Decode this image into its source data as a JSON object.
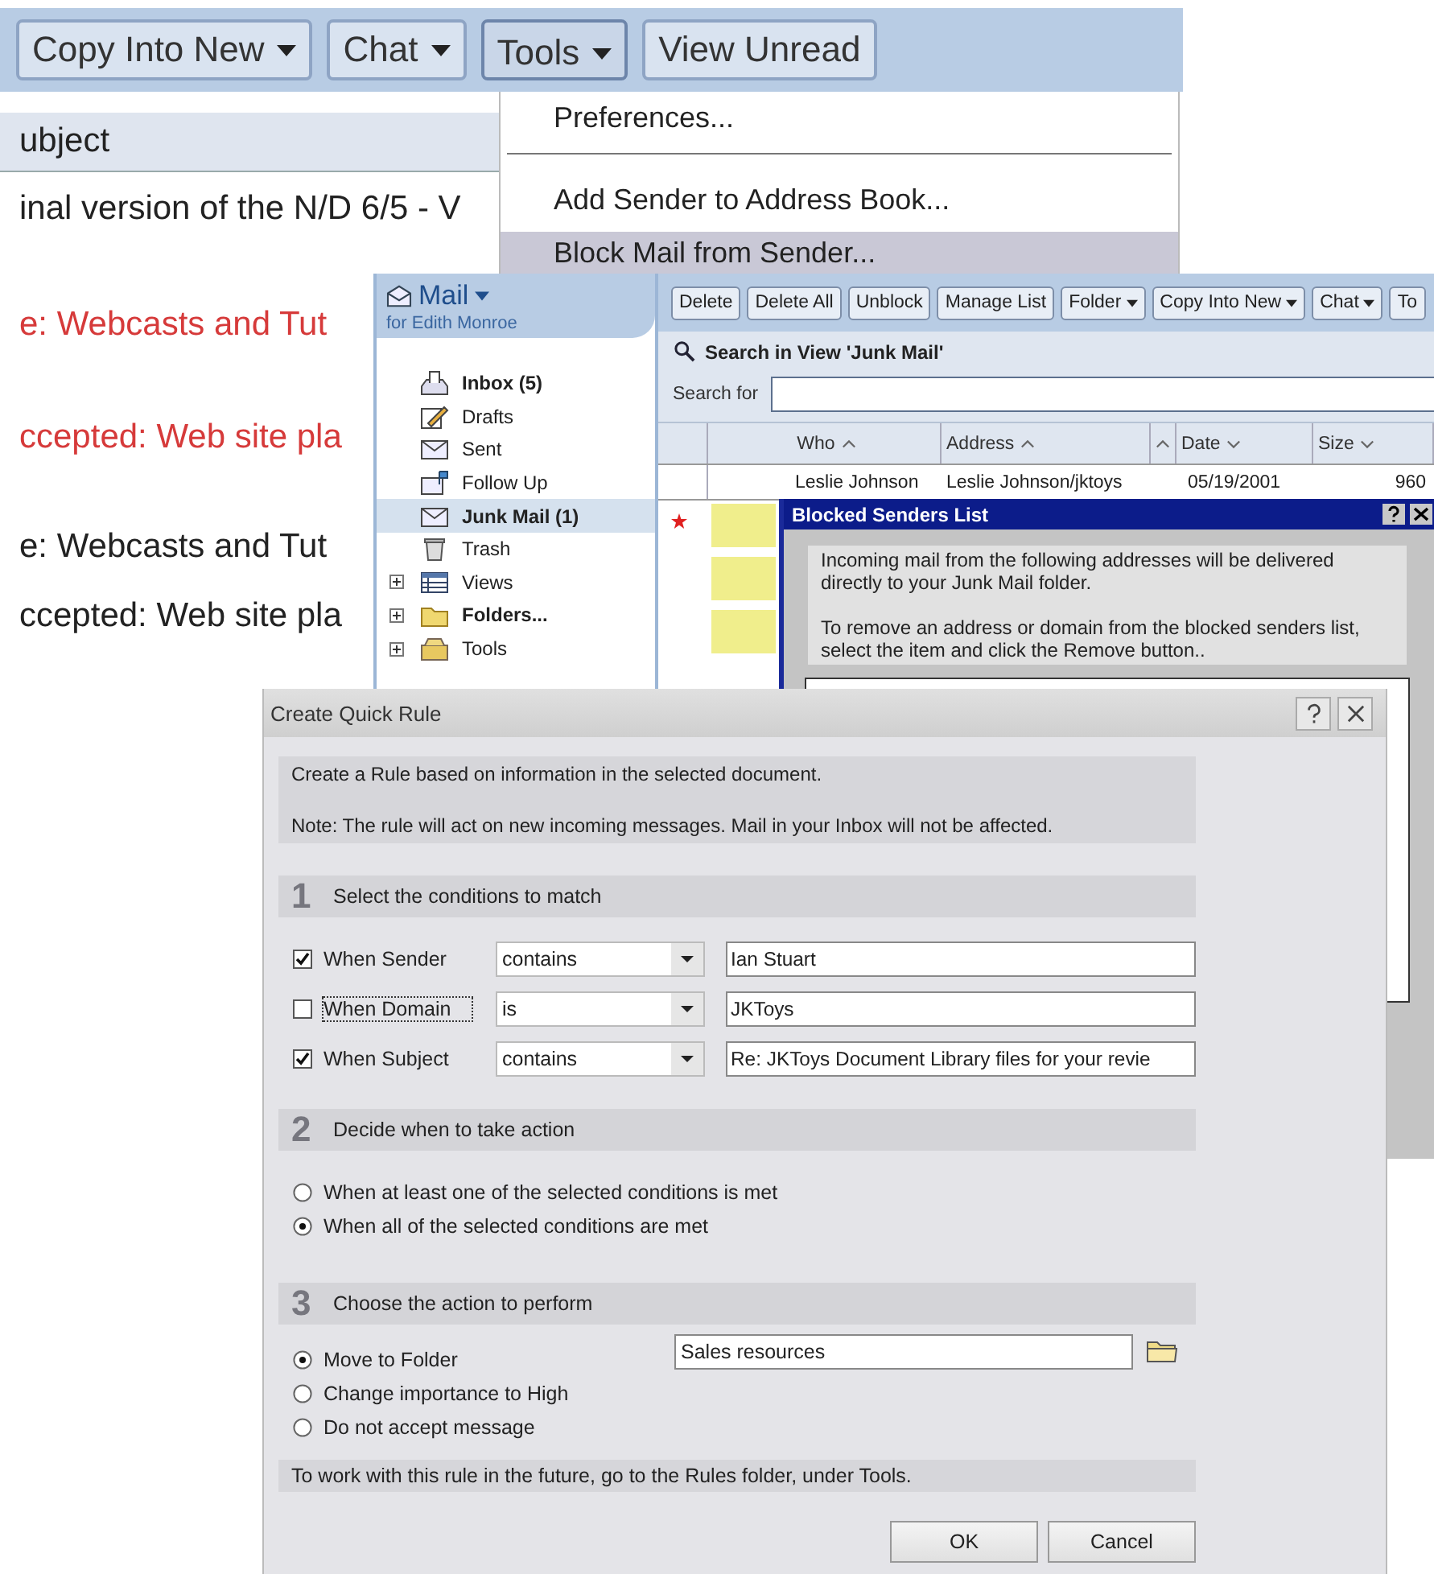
{
  "back_window": {
    "toolbar_buttons": [
      {
        "label": "Copy Into New",
        "dropdown": true,
        "pressed": false
      },
      {
        "label": "Chat",
        "dropdown": true,
        "pressed": false
      },
      {
        "label": "Tools",
        "dropdown": true,
        "pressed": true
      },
      {
        "label": "View Unread",
        "dropdown": false,
        "pressed": false
      }
    ],
    "column_header": "ubject",
    "rows": [
      {
        "text": "inal version of the N/D 6/5 - V",
        "unread": false
      },
      {
        "text": "e: Webcasts and Tut",
        "unread": true
      },
      {
        "text": "ccepted: Web site pla",
        "unread": true
      },
      {
        "text": "e: Webcasts and Tut",
        "unread": false
      },
      {
        "text": "ccepted: Web site pla",
        "unread": false
      }
    ],
    "menu": [
      {
        "label": "Preferences...",
        "selected": false,
        "separator_after": true
      },
      {
        "label": "Add Sender to Address Book...",
        "selected": false,
        "separator_after": false
      },
      {
        "label": "Block Mail from Sender...",
        "selected": true,
        "separator_after": false
      }
    ]
  },
  "mail_window": {
    "title": "Mail",
    "subtitle": "for Edith Monroe",
    "nav": [
      {
        "label": "Inbox (5)",
        "bold": true,
        "selected": false,
        "expandable": false
      },
      {
        "label": "Drafts",
        "bold": false,
        "selected": false,
        "expandable": false
      },
      {
        "label": "Sent",
        "bold": false,
        "selected": false,
        "expandable": false
      },
      {
        "label": "Follow Up",
        "bold": false,
        "selected": false,
        "expandable": false
      },
      {
        "label": "Junk Mail (1)",
        "bold": true,
        "selected": true,
        "expandable": false
      },
      {
        "label": "Trash",
        "bold": false,
        "selected": false,
        "expandable": false
      },
      {
        "label": "Views",
        "bold": false,
        "selected": false,
        "expandable": true
      },
      {
        "label": "Folders...",
        "bold": true,
        "selected": false,
        "expandable": true
      },
      {
        "label": "Tools",
        "bold": false,
        "selected": false,
        "expandable": true
      }
    ],
    "toolbar_buttons": [
      {
        "label": "Delete",
        "dropdown": false
      },
      {
        "label": "Delete All",
        "dropdown": false
      },
      {
        "label": "Unblock",
        "dropdown": false
      },
      {
        "label": "Manage List",
        "dropdown": false
      },
      {
        "label": "Folder",
        "dropdown": true
      },
      {
        "label": "Copy Into New",
        "dropdown": true
      },
      {
        "label": "Chat",
        "dropdown": true
      },
      {
        "label": "To",
        "dropdown": false
      }
    ],
    "search_title": "Search in View 'Junk Mail'",
    "search_label": "Search for",
    "columns": [
      {
        "label": "Who",
        "sort_up": true
      },
      {
        "label": "Address",
        "sort_up": true
      },
      {
        "sort_up": true
      },
      {
        "label": "Date",
        "sort_up": false
      },
      {
        "label": "Size",
        "sort_up": false
      }
    ],
    "rows": [
      {
        "cells": [
          "Leslie Johnson",
          "Leslie Johnson/jktoys",
          "",
          "05/19/2001",
          "960"
        ]
      }
    ],
    "blocked_dialog": {
      "title": "Blocked Senders List",
      "paragraphs": [
        "Incoming mail from the following addresses will be delivered directly to your Junk Mail folder.",
        "To remove an address or domain from the blocked senders list, select the item and click the Remove button.."
      ]
    }
  },
  "quick_rule": {
    "title": "Create Quick Rule",
    "intro": [
      "Create a Rule based on information in the selected document.",
      "Note: The rule will act on new incoming messages. Mail in your Inbox will not be affected."
    ],
    "sections": [
      {
        "number": "1",
        "title": "Select the conditions to match"
      },
      {
        "number": "2",
        "title": "Decide when to take action"
      },
      {
        "number": "3",
        "title": "Choose the action to perform"
      }
    ],
    "conditions": [
      {
        "label": "When Sender",
        "checked": true,
        "focused": false,
        "operator": "contains",
        "value": "Ian Stuart"
      },
      {
        "label": "When Domain",
        "checked": false,
        "focused": true,
        "operator": "is",
        "value": "JKToys"
      },
      {
        "label": "When Subject",
        "checked": true,
        "focused": false,
        "operator": "contains",
        "value": "Re: JKToys Document Library files for your revie"
      }
    ],
    "match_options": [
      {
        "label": "When at least one of the selected conditions is met",
        "selected": false
      },
      {
        "label": "When all of the selected conditions are met",
        "selected": true
      }
    ],
    "actions": [
      {
        "label": "Move to Folder",
        "selected": true
      },
      {
        "label": "Change importance to High",
        "selected": false
      },
      {
        "label": "Do not accept message",
        "selected": false
      }
    ],
    "folder": "Sales resources",
    "footer": "To work with this rule in the future, go to the Rules folder, under Tools.",
    "buttons": [
      "OK",
      "Cancel"
    ]
  }
}
